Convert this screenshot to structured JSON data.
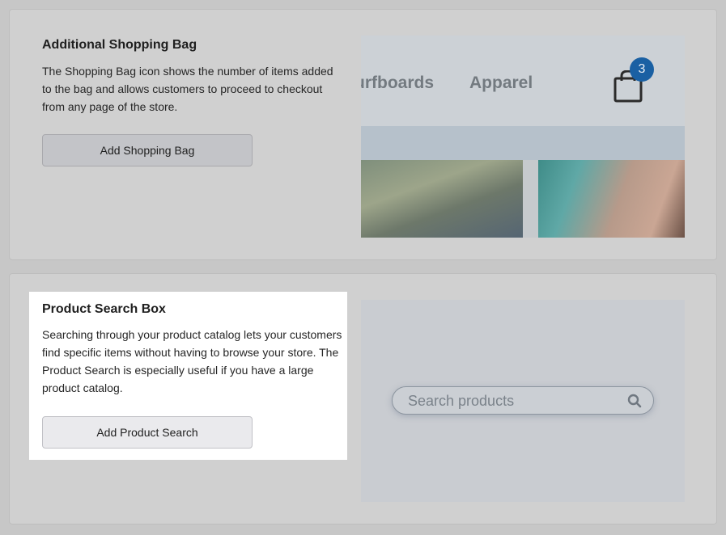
{
  "shopping_bag": {
    "title": "Additional Shopping Bag",
    "description": "The Shopping Bag icon shows the number of items added to the bag and allows customers to proceed to checkout from any page of the store.",
    "button_label": "Add Shopping Bag",
    "preview": {
      "nav_items": [
        "urfboards",
        "Apparel"
      ],
      "bag_count": "3",
      "badge_color": "#1a60a3",
      "icon": "shopping-bag-icon"
    }
  },
  "product_search": {
    "title": "Product Search Box",
    "description": "Searching through your product catalog lets your customers find specific items without having to browse your store. The Product Search is especially useful if you have a large product catalog.",
    "button_label": "Add Product Search",
    "preview": {
      "placeholder": "Search products",
      "icon": "search-icon"
    }
  }
}
